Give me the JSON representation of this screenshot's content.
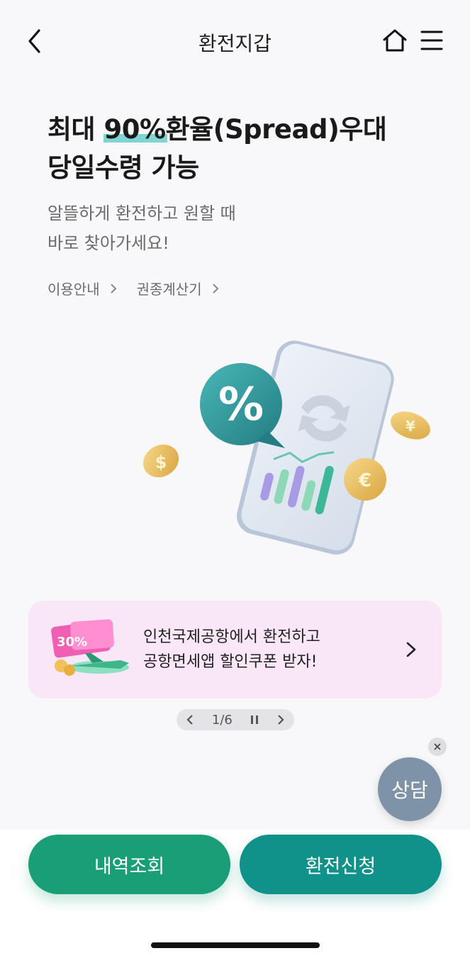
{
  "header": {
    "title": "환전지갑",
    "back_icon": "chevron-left-icon",
    "home_icon": "home-icon",
    "menu_icon": "hamburger-menu-icon"
  },
  "hero": {
    "headline_line1_prefix": "최대 ",
    "headline_highlight": "90% ",
    "headline_line1_suffix": "환율(Spread)우대",
    "headline_line2": "당일수령 가능",
    "subtitle_line1": "알뜰하게 환전하고 원할 때",
    "subtitle_line2": "바로 찾아가세요!",
    "highlight_color": "#7fd4d4",
    "links": [
      {
        "label": "이용안내"
      },
      {
        "label": "권종계산기"
      }
    ]
  },
  "banner": {
    "badge_text": "30%",
    "line1": "인천국제공항에서 환전하고",
    "line2": "공항면세앱 할인쿠폰 받자!",
    "background": "#f9e6f7"
  },
  "pager": {
    "counter": "1/6"
  },
  "chat": {
    "label": "상담"
  },
  "actions": {
    "history_label": "내역조회",
    "apply_label": "환전신청",
    "history_color": "#1a9e78",
    "apply_color": "#10928b"
  }
}
